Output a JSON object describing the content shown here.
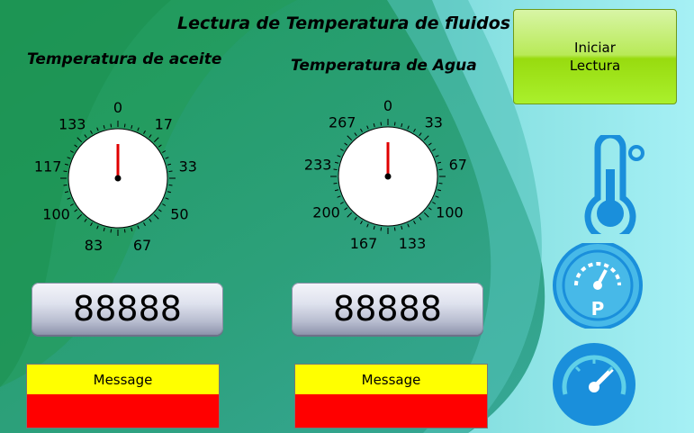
{
  "header": {
    "title": "Lectura de Temperatura de fluidos"
  },
  "gauges": [
    {
      "title": "Temperatura de aceite",
      "tick_labels": [
        "0",
        "17",
        "33",
        "50",
        "67",
        "83",
        "100",
        "117",
        "133"
      ],
      "needle_value": 0,
      "readout": "88888",
      "message": "Message"
    },
    {
      "title": "Temperatura de Agua",
      "tick_labels": [
        "0",
        "33",
        "67",
        "100",
        "133",
        "167",
        "200",
        "233",
        "267"
      ],
      "needle_value": 0,
      "readout": "88888",
      "message": "Message"
    }
  ],
  "start_button": {
    "line1": "Iniciar",
    "line2": "Lectura"
  },
  "icons": [
    "thermometer-icon",
    "pressure-gauge-icon",
    "speedometer-icon"
  ],
  "colors": {
    "button_green": "#9be21a",
    "message_yellow": "#ffff00",
    "message_red": "#ff0000",
    "icon_blue": "#1a8fdb",
    "needle_red": "#e00000"
  }
}
